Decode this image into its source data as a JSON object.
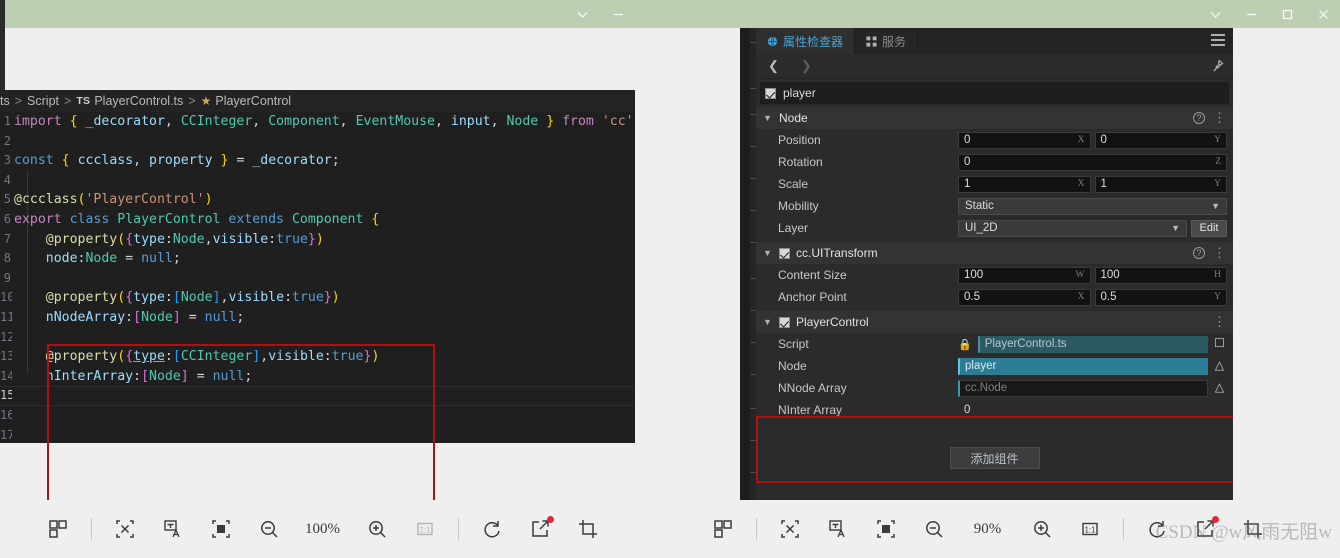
{
  "window_left": {
    "title_controls": [
      "chevron-down",
      "minimize"
    ]
  },
  "window_right": {
    "title_controls": [
      "chevron-down",
      "minimize",
      "maximize",
      "close"
    ]
  },
  "editor": {
    "breadcrumb": {
      "part1": "ts",
      "part2": "Script",
      "ts_badge": "TS",
      "file": "PlayerControl.ts",
      "symbol": "PlayerControl",
      "separator": ">"
    },
    "line_numbers": [
      "1",
      "2",
      "3",
      "4",
      "5",
      "6",
      "7",
      "8",
      "9",
      "10",
      "11",
      "12",
      "13",
      "14",
      "15",
      "16",
      "17"
    ],
    "current_line": "15",
    "code_text": "import { _decorator, CCInteger, Component, EventMouse, input, Node } from 'cc'\n\nconst { ccclass, property } = _decorator;\n\n@ccclass('PlayerControl')\nexport class PlayerControl extends Component {\n    @property({type:Node,visible:true})\n    node:Node = null;\n\n    @property({type:[Node],visible:true})\n    nNodeArray:[Node] = null;\n\n    @property({type:[CCInteger],visible:true})\n    nInterArray:[Node] = null;\n",
    "highlight_box_color": "#b01010"
  },
  "inspector": {
    "tabs": [
      {
        "label": "属性检查器",
        "icon": "inspector-icon",
        "active": true
      },
      {
        "label": "服务",
        "icon": "grid-icon",
        "active": false
      }
    ],
    "node_name": "player",
    "node_enabled": true,
    "sections": [
      {
        "id": "node",
        "title": "Node",
        "has_checkbox": false,
        "expanded": true,
        "help": "?",
        "rows": [
          {
            "label": "Position",
            "type": "fields",
            "fields": [
              {
                "value": "0",
                "axis": "X"
              },
              {
                "value": "0",
                "axis": "Y"
              }
            ]
          },
          {
            "label": "Rotation",
            "type": "fields",
            "fields": [
              {
                "value": "0",
                "axis": "Z",
                "full": true
              }
            ]
          },
          {
            "label": "Scale",
            "type": "fields",
            "fields": [
              {
                "value": "1",
                "axis": "X"
              },
              {
                "value": "1",
                "axis": "Y"
              }
            ]
          },
          {
            "label": "Mobility",
            "type": "select",
            "value": "Static"
          },
          {
            "label": "Layer",
            "type": "select_edit",
            "value": "UI_2D",
            "button": "Edit"
          }
        ]
      },
      {
        "id": "ui-transform",
        "title": "cc.UITransform",
        "has_checkbox": true,
        "expanded": true,
        "help": "?",
        "rows": [
          {
            "label": "Content Size",
            "type": "fields",
            "fields": [
              {
                "value": "100",
                "axis": "W"
              },
              {
                "value": "100",
                "axis": "H"
              }
            ]
          },
          {
            "label": "Anchor Point",
            "type": "fields",
            "fields": [
              {
                "value": "0.5",
                "axis": "X"
              },
              {
                "value": "0.5",
                "axis": "Y"
              }
            ]
          }
        ]
      },
      {
        "id": "player-control",
        "title": "PlayerControl",
        "has_checkbox": true,
        "expanded": true,
        "help": "",
        "rows": [
          {
            "label": "Script",
            "type": "script",
            "value": "PlayerControl.ts",
            "lock": "lock-icon",
            "tail": "script-icon"
          },
          {
            "label": "Node",
            "type": "node_ref",
            "value": "player",
            "tail": "node-icon",
            "highlighted": true
          },
          {
            "label": "NNode Array",
            "type": "node_ref_empty",
            "value": "cc.Node",
            "tail": "node-icon",
            "highlighted": true
          },
          {
            "label": "NInter Array",
            "type": "plain",
            "value": "0",
            "highlighted": true
          }
        ]
      }
    ],
    "add_component_button": "添加组件",
    "highlight_box_color": "#b01010"
  },
  "toolbar_left": {
    "zoom": "100%",
    "icons": [
      "layout-icon",
      "fit-icon",
      "translate-icon",
      "fullscreen-icon",
      "zoom-out-icon",
      "zoom-in-icon",
      "actual-size-icon",
      "rotate-icon",
      "edit-icon",
      "crop-icon"
    ]
  },
  "toolbar_right": {
    "zoom": "90%",
    "icons": [
      "layout-icon",
      "fit-icon",
      "translate-icon",
      "fullscreen-icon",
      "zoom-out-icon",
      "zoom-in-icon",
      "actual-size-icon",
      "rotate-icon",
      "edit-icon",
      "crop-icon"
    ]
  },
  "watermark": "CSDN @w风雨无阻w",
  "colors": {
    "titlebar": "#bdcfb2",
    "editor_bg": "#1f1f1f",
    "panel_bg": "#2b2b2b",
    "accent_teal": "#2a7d95",
    "highlight_red": "#b01010",
    "tab_active": "#4aa3d6"
  }
}
